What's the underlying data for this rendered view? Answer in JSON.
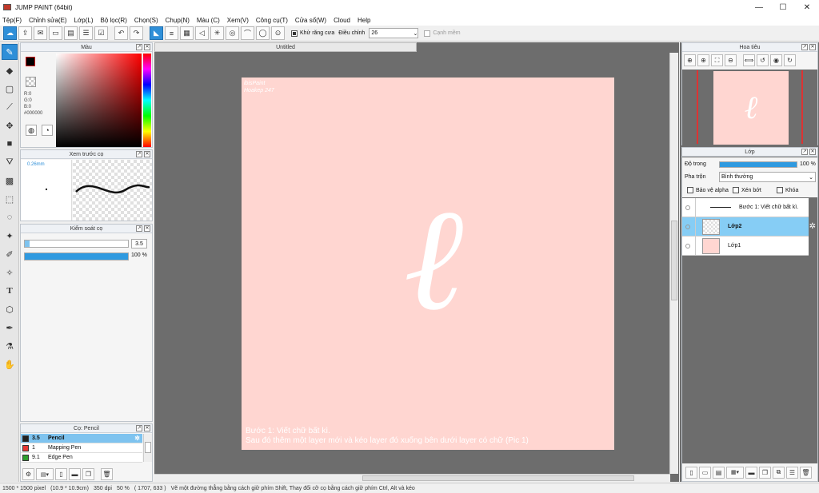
{
  "app": {
    "title": "JUMP PAINT (64bit)"
  },
  "window_controls": {
    "minimize": "—",
    "maximize": "☐",
    "close": "✕"
  },
  "menu": [
    "Tệp(F)",
    "Chỉnh sửa(E)",
    "Lớp(L)",
    "Bộ lọc(R)",
    "Chọn(S)",
    "Chụp(N)",
    "Màu (C)",
    "Xem(V)",
    "Công cụ(T)",
    "Cửa sổ(W)",
    "Cloud",
    "Help"
  ],
  "toolbar": {
    "antialias_label": "Khử răng cưa",
    "adjust_label": "Điều chỉnh",
    "adjust_value": "26",
    "snap_label": "Cạnh mềm"
  },
  "color_panel": {
    "title": "Màu",
    "r": "R:0",
    "g": "G:0",
    "b": "B:0",
    "hex": "#000000",
    "fg_color": "#000000",
    "bg_color": "#8b2a0e"
  },
  "brush_preview": {
    "title": "Xem trước cọ",
    "size": "0.26mm"
  },
  "brush_control": {
    "title": "Kiểm soát cọ",
    "size_value": "3.5",
    "opacity_value": "100 %",
    "opacity_fill": 1.0
  },
  "brush_list": {
    "title": "Cọ: Pencil",
    "items": [
      {
        "size": "3.5",
        "name": "Pencil",
        "color": "#222222",
        "selected": true
      },
      {
        "size": "1",
        "name": "Mapping Pen",
        "color": "#e53935",
        "selected": false
      },
      {
        "size": "9.1",
        "name": "Edge Pen",
        "color": "#2e9e2e",
        "selected": false
      }
    ]
  },
  "document": {
    "tab_title": "Untitled",
    "watermark_line1": "ibisPaint",
    "watermark_line2": "Hoakep 247",
    "glyph": "ℓ",
    "caption_line1": "Bước 1: Viết chữ bất kì.",
    "caption_line2": "Sau đó thêm một layer mới và kéo layer đó xuống bên dưới layer có chữ (Pic 1)",
    "canvas_color": "#ffd6d1"
  },
  "navigator": {
    "title": "Hoa tiêu",
    "glyph": "ℓ"
  },
  "layers": {
    "title": "Lớp",
    "opacity_label": "Độ trong",
    "opacity_value": "100 %",
    "opacity_fill": 1.0,
    "blend_label": "Pha trộn",
    "blend_value": "Bình thường",
    "protect_alpha": "Bảo vệ alpha",
    "clipping": "Xén bớt",
    "lock": "Khóa",
    "items": [
      {
        "name": "Bước 1: Viết chữ bất kì.",
        "type": "text",
        "selected": false
      },
      {
        "name": "Lớp2",
        "type": "transparent",
        "selected": true
      },
      {
        "name": "Lớp1",
        "type": "pink",
        "selected": false
      }
    ]
  },
  "status": {
    "size": "1500 * 1500 pixel",
    "dimension": "(10.9 * 10.9cm)",
    "dpi": "350 dpi",
    "zoom": "50 %",
    "coords": "( 1707, 633 )",
    "hint": "Vẽ một đường thẳng bằng cách giữ phím Shift, Thay đổi cỡ cọ bằng cách giữ phím Ctrl, Alt và kéo"
  },
  "icons": {
    "titlebar": "app-logo-icon",
    "tools": [
      "brush-icon",
      "eraser-icon",
      "rectangle-icon",
      "line-icon",
      "move-icon",
      "fill-rect-icon",
      "bucket-icon",
      "gradient-icon",
      "select-rect-icon",
      "lasso-icon",
      "magic-wand-icon",
      "select-pen-icon",
      "select-eraser-icon",
      "text-icon",
      "shape-select-icon",
      "pen-icon",
      "eyedropper-icon",
      "hand-icon"
    ]
  }
}
